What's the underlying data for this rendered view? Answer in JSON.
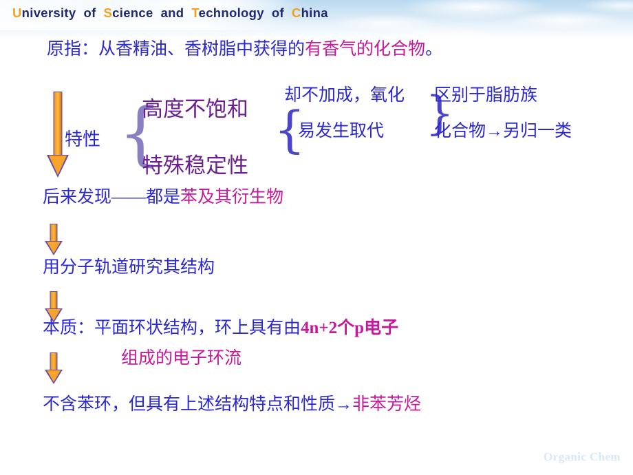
{
  "banner": {
    "title_parts": [
      {
        "t": "U",
        "cap": true
      },
      {
        "t": "niversity",
        "cap": false
      },
      {
        "t": "of",
        "cap": false,
        "word": true
      },
      {
        "t": "S",
        "cap": true
      },
      {
        "t": "cience",
        "cap": false
      },
      {
        "t": "and",
        "cap": false,
        "word": true
      },
      {
        "t": "T",
        "cap": true
      },
      {
        "t": "echnology",
        "cap": false
      },
      {
        "t": "of",
        "cap": false,
        "word": true
      },
      {
        "t": "C",
        "cap": true
      },
      {
        "t": "hina",
        "cap": false
      }
    ],
    "title_plain": "University of Science and Technology of China",
    "accent_color": "#f5a01b",
    "text_color": "#1f2a6e"
  },
  "slide": {
    "line1": {
      "blue_a": "原指：从香精油、香树脂中获得的",
      "magenta": "有香气的化合物",
      "blue_b": "。"
    },
    "feature_label": "特性",
    "feature_items": [
      "高度不饱和",
      "特殊稳定性"
    ],
    "reaction_items": [
      "却不加成，氧化",
      "易发生取代"
    ],
    "distinction": [
      "区别于脂肪族",
      "化合物→另归一类"
    ],
    "line_found": {
      "blue": "后来发现——都是",
      "magenta": "苯及其衍生物"
    },
    "line_mo": "用分子轨道研究其结构",
    "line_essence": {
      "blue": "本质：平面环状结构，环上具有由",
      "magenta": "4n+2个p电子",
      "magenta2": "组成的电子环流"
    },
    "line_last": {
      "blue": "不含苯环，但具有上述结构特点和性质→",
      "magenta": "非苯芳烃"
    },
    "colors": {
      "blue": "#2b28cf",
      "magenta": "#c4199b",
      "purple": "#6b1f8f",
      "arrow_fill": "#f6a42a",
      "arrow_outline": "#6b4fa8",
      "brace": "#8b7fc4",
      "footer": "#d8e8f7"
    }
  },
  "footer": {
    "text": "Organic Chem"
  }
}
